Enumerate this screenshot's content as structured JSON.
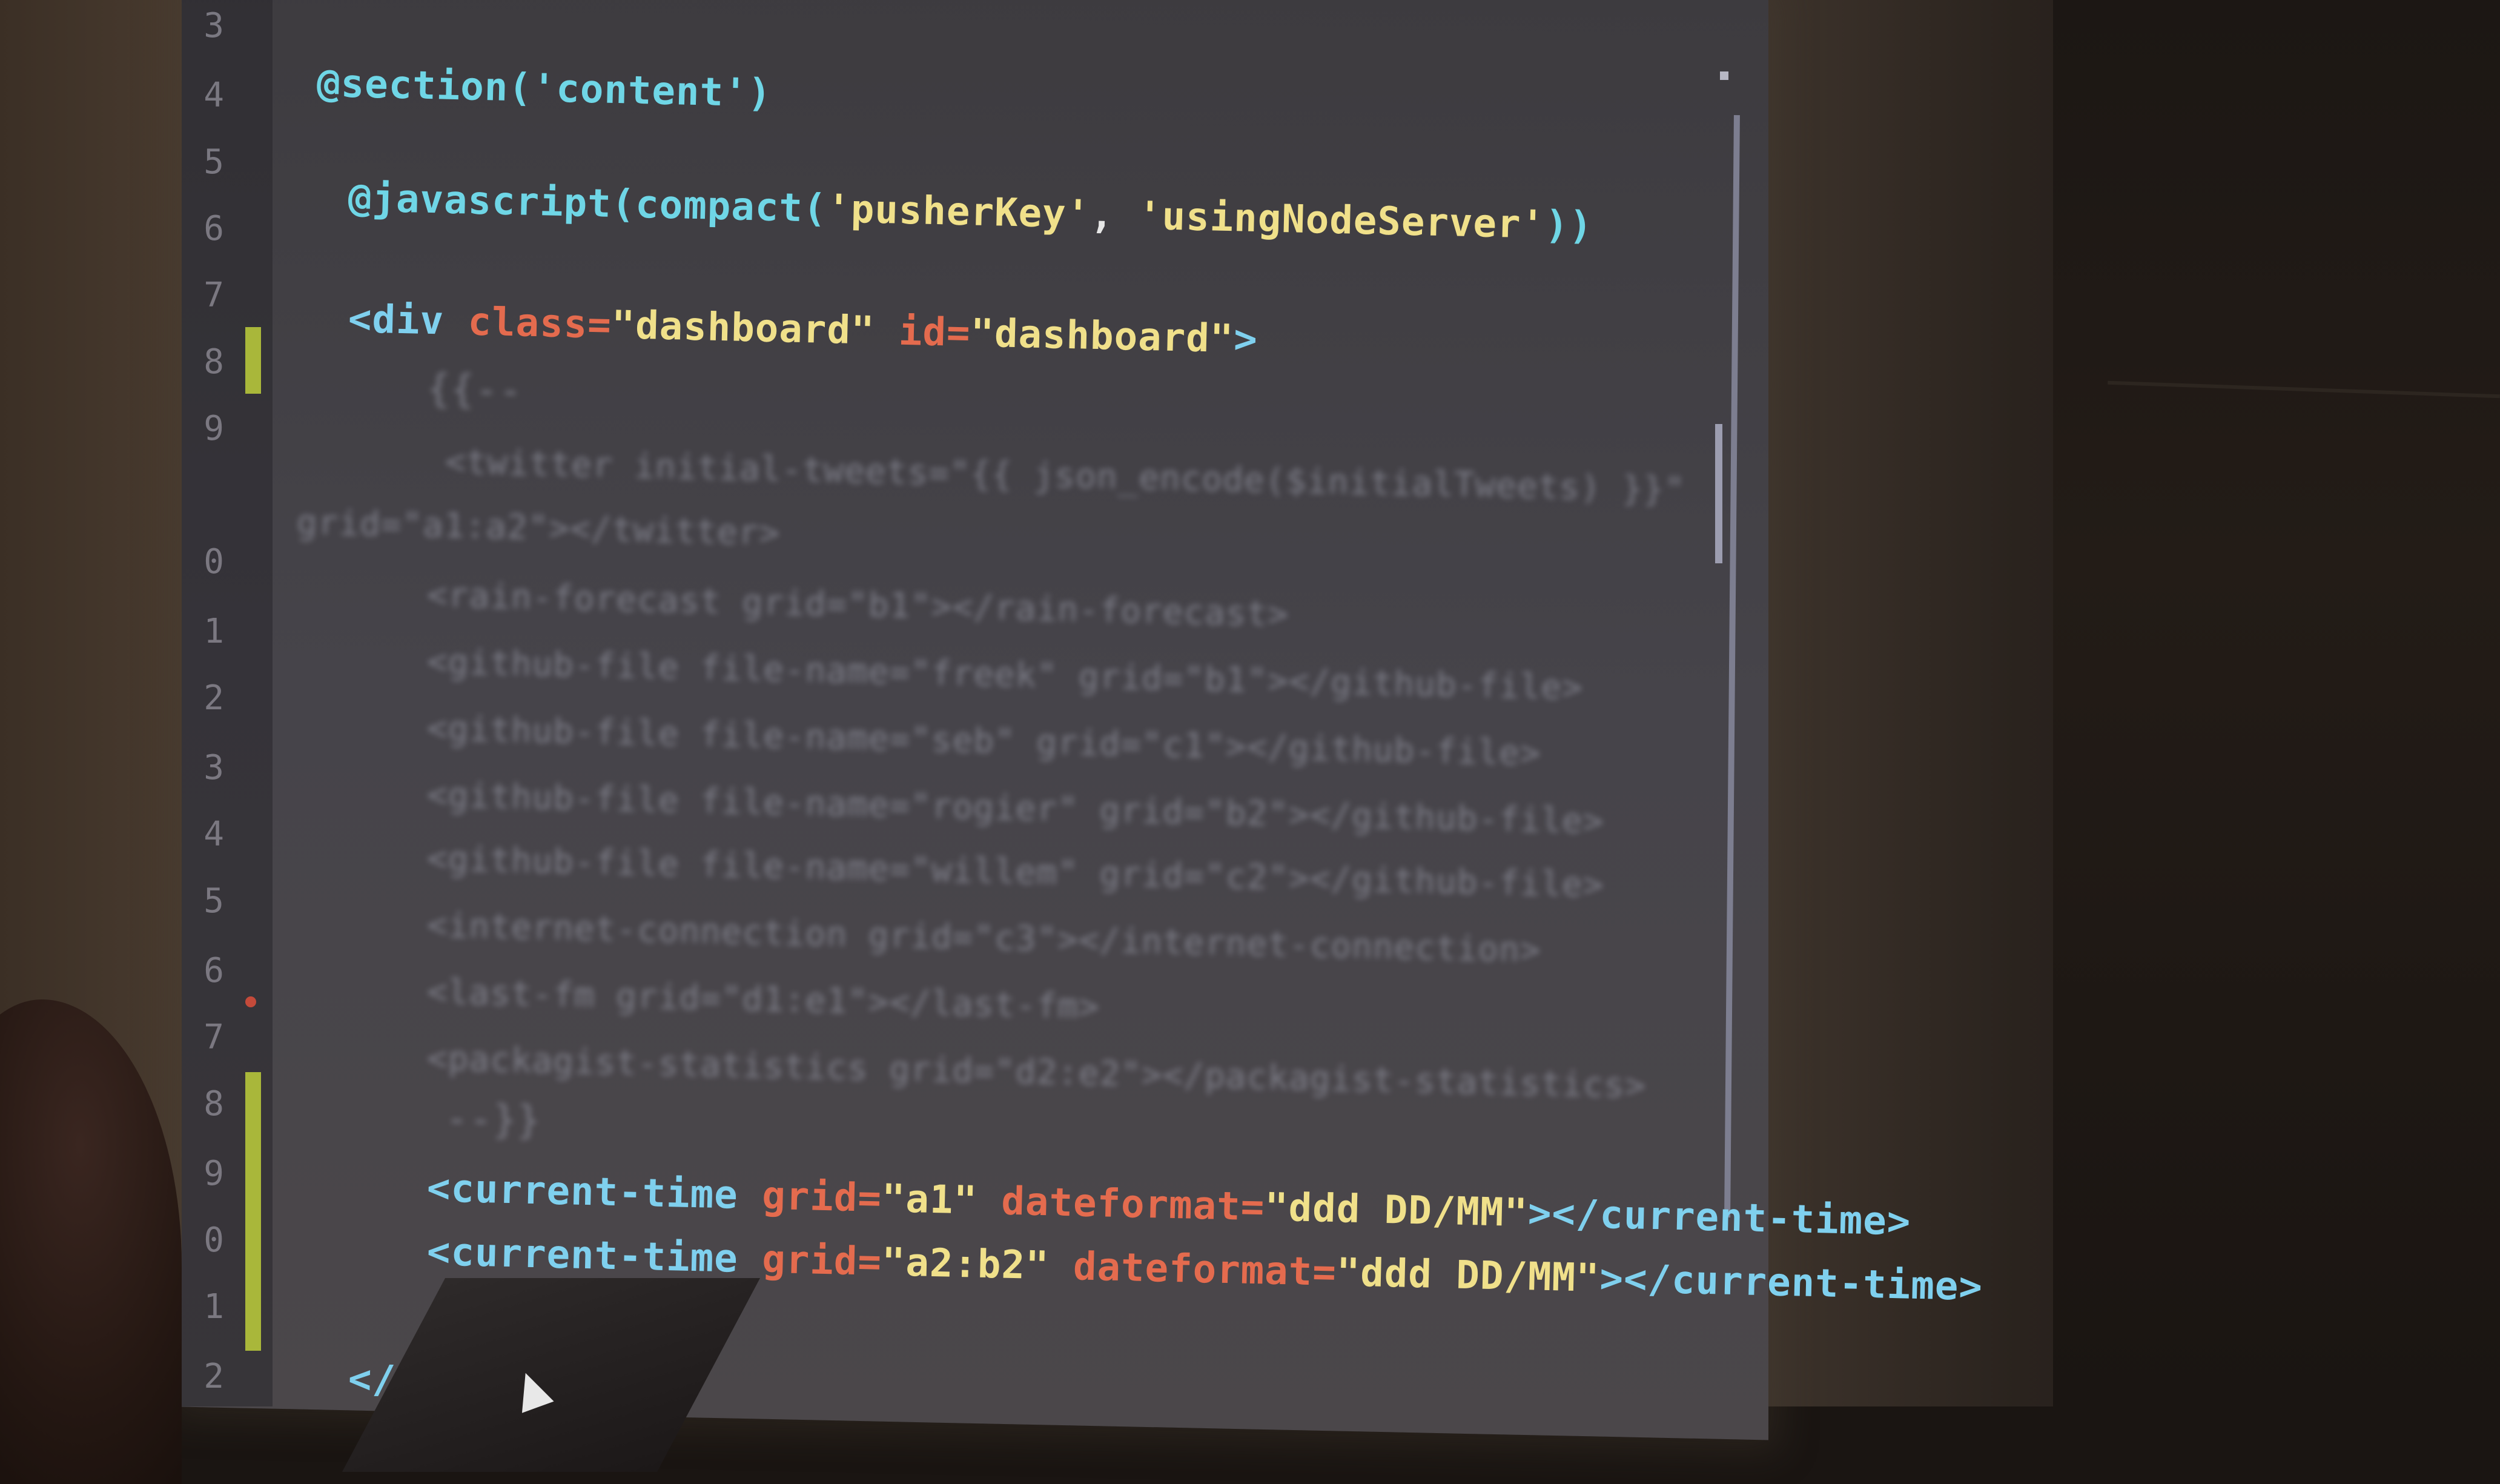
{
  "scene": "presentation-slide-photo",
  "editor": {
    "line_numbers": [
      "3",
      "4",
      "5",
      "6",
      "7",
      "8",
      "9",
      "0",
      "1",
      "2",
      "3",
      "4",
      "5",
      "6",
      "7",
      "8",
      "9",
      "0",
      "1",
      "2"
    ],
    "lines": {
      "l3": "@section('content')",
      "l5_fn": "@javascript(",
      "l5_fn2": "compact(",
      "l5_s1": "'pusherKey'",
      "l5_sep": ", ",
      "l5_s2": "'usingNodeServer'",
      "l5_end": "))",
      "l7_open": "<div ",
      "l7_attr1": "class=",
      "l7_val1": "\"dashboard\"",
      "l7_attr2": " id=",
      "l7_val2": "\"dashboard\"",
      "l7_close": ">",
      "l8": "{{--",
      "l9a": "<twitter initial-tweets=\"{{ json_encode($initialTweets) }}\"",
      "l9b": "grid=\"a1:a2\"></twitter>",
      "l10": "<rain-forecast grid=\"b1\"></rain-forecast>",
      "l11": "<github-file file-name=\"freek\" grid=\"b1\"></github-file>",
      "l12": "<github-file file-name=\"seb\" grid=\"c1\"></github-file>",
      "l13": "<github-file file-name=\"rogier\" grid=\"b2\"></github-file>",
      "l14": "<github-file file-name=\"willem\" grid=\"c2\"></github-file>",
      "l15": "<internet-connection grid=\"c3\"></internet-connection>",
      "l16": "<last-fm grid=\"d1:e1\"></last-fm>",
      "l17": "<packagist-statistics grid=\"d2:e2\"></packagist-statistics>",
      "l18": "--}}",
      "l19_open": "<current-time ",
      "l19_a1": "grid=",
      "l19_v1": "\"a1\"",
      "l19_a2": " dateformat=",
      "l19_v2": "\"ddd DD/MM\"",
      "l19_close": "></current-time>",
      "l20_open": "<current-time ",
      "l20_a1": "grid=",
      "l20_v1": "\"a2:b2\"",
      "l20_a2": " dateformat=",
      "l20_v2": "\"ddd DD/MM\"",
      "l20_close": "></current-time>",
      "l22": "</"
    }
  }
}
